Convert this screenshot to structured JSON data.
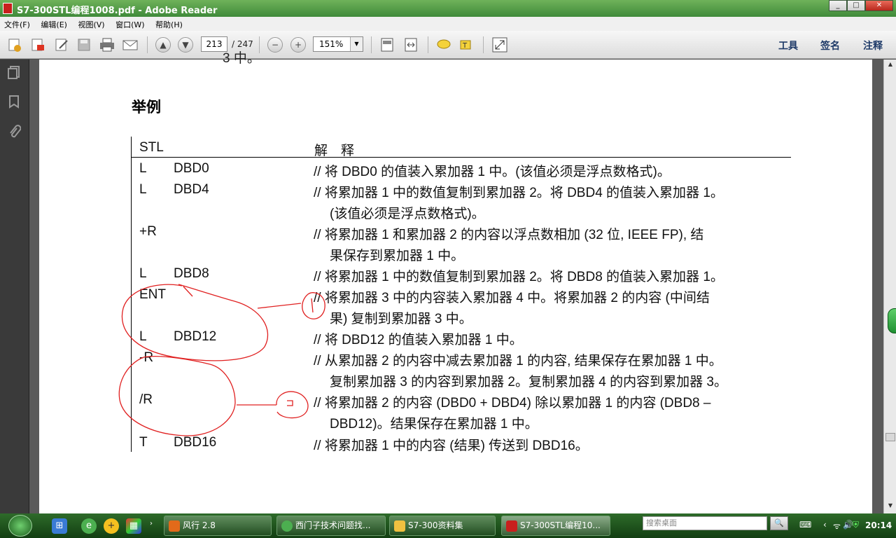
{
  "window": {
    "title": "S7-300STL编程1008.pdf - Adobe Reader",
    "minimize": "_",
    "maximize": "□",
    "close": "✕"
  },
  "menu": [
    "文件(F)",
    "编辑(E)",
    "视图(V)",
    "窗口(W)",
    "帮助(H)"
  ],
  "toolbar": {
    "page_current": "213",
    "page_total": "/ 247",
    "zoom": "151%",
    "tools": "工具",
    "sign": "签名",
    "comment": "注释",
    "icons": [
      "create-icon",
      "export-pdf-icon",
      "edit-icon",
      "save-icon",
      "print-icon",
      "email-icon",
      "prev-page-icon",
      "next-page-icon",
      "zoom-out-icon",
      "zoom-in-icon",
      "fit-page-icon",
      "fit-width-icon",
      "comment-icon",
      "highlight-icon",
      "fullscreen-icon"
    ]
  },
  "document": {
    "top_fragment": "3 中。",
    "heading": "举例",
    "col_stl": "STL",
    "col_expl": "解　释",
    "rows": [
      {
        "op": "L",
        "arg": "DBD0",
        "c1": "// 将 DBD0 的值装入累加器 1 中。(该值必须是浮点数格式)。",
        "c2": ""
      },
      {
        "op": "L",
        "arg": "DBD4",
        "c1": "// 将累加器 1 中的数值复制到累加器 2。将 DBD4 的值装入累加器 1。",
        "c2": "(该值必须是浮点数格式)。"
      },
      {
        "op": "+R",
        "arg": "",
        "c1": "// 将累加器 1 和累加器 2 的内容以浮点数相加 (32 位, IEEE FP), 结",
        "c2": "果保存到累加器 1 中。"
      },
      {
        "op": "L",
        "arg": "DBD8",
        "c1": "// 将累加器 1 中的数值复制到累加器 2。将 DBD8 的值装入累加器 1。",
        "c2": ""
      },
      {
        "op": "ENT",
        "arg": "",
        "c1": "// 将累加器 3 中的内容装入累加器 4 中。将累加器 2 的内容 (中间结",
        "c2": "果) 复制到累加器 3 中。"
      },
      {
        "op": "L",
        "arg": "DBD12",
        "c1": "// 将 DBD12 的值装入累加器 1 中。",
        "c2": ""
      },
      {
        "op": "-R",
        "arg": "",
        "c1": "// 从累加器 2 的内容中减去累加器 1 的内容, 结果保存在累加器 1 中。",
        "c2": "复制累加器 3 的内容到累加器 2。复制累加器 4 的内容到累加器 3。"
      },
      {
        "op": "/R",
        "arg": "",
        "c1": "// 将累加器 2 的内容 (DBD0 + DBD4) 除以累加器 1 的内容 (DBD8 –",
        "c2": "DBD12)。结果保存在累加器 1 中。"
      },
      {
        "op": "T",
        "arg": "DBD16",
        "c1": "// 将累加器 1 中的内容 (结果) 传送到 DBD16。",
        "c2": ""
      }
    ],
    "annotation_1": "1",
    "annotation_2": "2"
  },
  "taskbar": {
    "tasks": [
      "风行 2.8",
      "西门子技术问题找...",
      "S7-300资料集",
      "S7-300STL编程10..."
    ],
    "search_placeholder": "搜索桌面",
    "time": "20:14"
  },
  "colors": {
    "titlebar": "#4f9a46",
    "taskbar": "#1f5a1f",
    "annotation": "#e02020",
    "heading_link": "#1e3a68"
  }
}
